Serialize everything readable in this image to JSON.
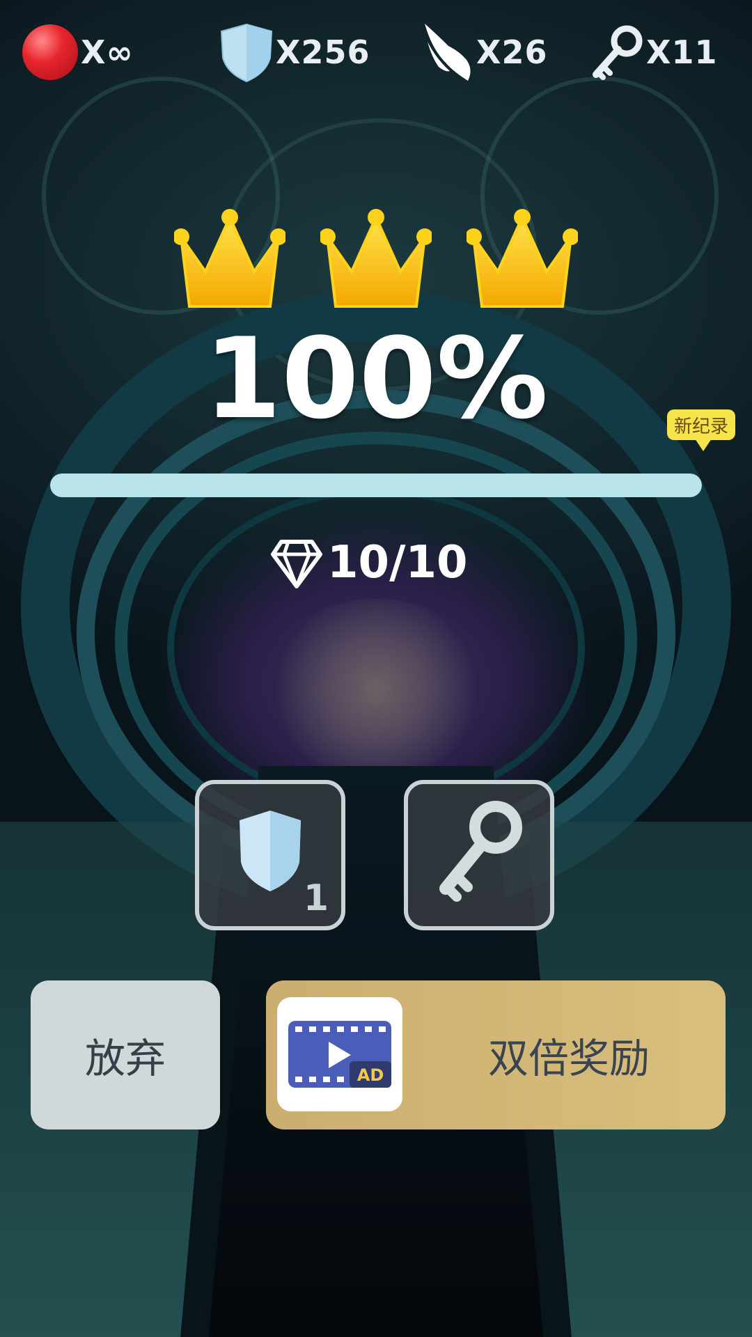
{
  "resources": {
    "lives": "X∞",
    "shields": "X256",
    "wings": "X26",
    "keys": "X11"
  },
  "result": {
    "crowns_earned": 3,
    "crowns_total": 3,
    "percent_label": "100%",
    "progress_fraction": 1.0,
    "new_record_badge": "新纪录",
    "gems_label": "10/10"
  },
  "items": [
    {
      "icon": "shield-icon",
      "count": "1"
    },
    {
      "icon": "key-icon",
      "count": ""
    }
  ],
  "buttons": {
    "give_up": "放弃",
    "double_reward": "双倍奖励",
    "ad_icon_label": "AD"
  },
  "colors": {
    "crown": "#f5c200",
    "progress": "#b8e4ea",
    "double_button": "#d2b676",
    "give_up_button": "#d0d8d9",
    "record_badge": "#f7e34a"
  }
}
